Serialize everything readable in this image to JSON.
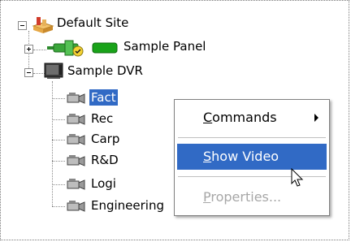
{
  "tree": {
    "root": {
      "label": "Default Site",
      "icon": "site-icon",
      "expanded": true
    },
    "children": [
      {
        "label": "Sample Panel",
        "icon": "access-panel-icon",
        "expanded": false
      },
      {
        "label": "Sample DVR",
        "icon": "dvr-icon",
        "expanded": true,
        "cameras": [
          {
            "label": "Fact",
            "selected": true
          },
          {
            "label": "Rec"
          },
          {
            "label": "Carp"
          },
          {
            "label": "R&D"
          },
          {
            "label": "Logi"
          },
          {
            "label": "Engineering"
          }
        ]
      }
    ]
  },
  "context_menu": {
    "items": [
      {
        "label": "Commands",
        "underline": "C",
        "rest": "ommands",
        "has_submenu": true,
        "enabled": true
      },
      {
        "label": "Show Video",
        "underline": "S",
        "rest": "how Video",
        "highlighted": true,
        "enabled": true
      },
      {
        "label": "Properties...",
        "underline": "P",
        "rest": "roperties...",
        "enabled": false
      }
    ]
  },
  "colors": {
    "selection": "#316ac5",
    "disabled_text": "#a7a7a7"
  }
}
